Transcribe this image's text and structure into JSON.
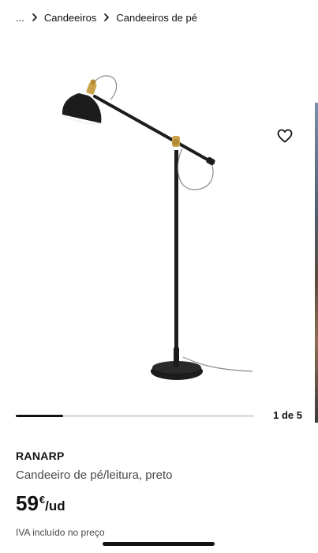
{
  "breadcrumb": {
    "items": [
      "...",
      "Candeeiros",
      "Candeeiros de pé"
    ]
  },
  "gallery": {
    "favourite_icon": "heart-outline-icon",
    "current_page": 1,
    "total_pages": 5,
    "counter": "1 de 5"
  },
  "product": {
    "name": "RANARP",
    "description": "Candeeiro de pé/leitura, preto",
    "price_amount": "59",
    "price_currency": "€",
    "price_unit": "/ud",
    "vat_note": "IVA incluído no preço"
  },
  "colors": {
    "text": "#111111",
    "secondary_text": "#484848",
    "lamp_black": "#1c1c1c",
    "brass": "#c9a24a"
  }
}
